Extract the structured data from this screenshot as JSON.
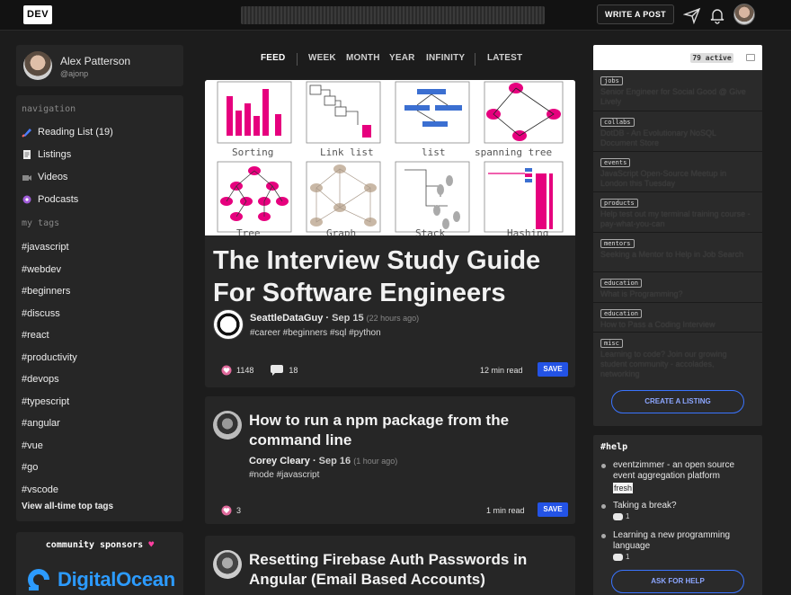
{
  "topnav": {
    "logo": "DEV",
    "write_post": "WRITE A POST"
  },
  "profile": {
    "name": "Alex Patterson",
    "handle": "@ajonp"
  },
  "sidebar": {
    "nav_title": "navigation",
    "nav_items": [
      {
        "label": "Reading List (19)",
        "icon": "bookmark-icon"
      },
      {
        "label": "Listings",
        "icon": "listings-icon"
      },
      {
        "label": "Videos",
        "icon": "camera-icon"
      },
      {
        "label": "Podcasts",
        "icon": "podcast-icon"
      }
    ],
    "tags_title": "my tags",
    "tags": [
      "#javascript",
      "#webdev",
      "#beginners",
      "#discuss",
      "#react",
      "#productivity",
      "#devops",
      "#typescript",
      "#angular",
      "#vue",
      "#go",
      "#vscode"
    ],
    "view_all": "View all-time top tags"
  },
  "sponsors": {
    "title": "community sponsors",
    "sponsor_name": "DigitalOcean"
  },
  "feed_tabs": [
    "FEED",
    "WEEK",
    "MONTH",
    "YEAR",
    "INFINITY",
    "LATEST"
  ],
  "featured": {
    "cover_labels": [
      "Sorting",
      "Link list",
      "list",
      "spanning tree",
      "Tree",
      "Graph",
      "Stack",
      "Hashing"
    ],
    "title": "The Interview Study Guide For Software Engineers",
    "author": "SeattleDataGuy",
    "date": "Sep 15",
    "ago": "(22 hours ago)",
    "tags": "#career #beginners #sql #python",
    "reactions": "1148",
    "comments": "18",
    "read_time": "12 min read",
    "save": "SAVE"
  },
  "posts": [
    {
      "title": "How to run a npm package from the command line",
      "author": "Corey Cleary",
      "date": "Sep 16",
      "ago": "(1 hour ago)",
      "tags": "#node #javascript",
      "reactions": "3",
      "read_time": "1 min read",
      "save": "SAVE"
    },
    {
      "title": "Resetting Firebase Auth Passwords in Angular (Email Based Accounts)"
    }
  ],
  "listings": {
    "active": "79 active",
    "rows": [
      {
        "badge": "jobs",
        "text": "Senior Engineer for Social Good @ Give Lively"
      },
      {
        "badge": "collabs",
        "text": "DotDB - An Evolutionary NoSQL Document Store"
      },
      {
        "badge": "events",
        "text": "JavaScript Open-Source Meetup in London this Tuesday"
      },
      {
        "badge": "products",
        "text": "Help test out my terminal training course - pay-what-you-can"
      },
      {
        "badge": "mentors",
        "text": "Seeking a Mentor to Help in Job Search"
      },
      {
        "badge": "education",
        "text": "What is Programming?"
      },
      {
        "badge": "education",
        "text": "How to Pass a Coding Interview"
      },
      {
        "badge": "misc",
        "text": "Learning to code? Join our growing student community - accolades, networking"
      }
    ],
    "create": "CREATE A LISTING"
  },
  "help": {
    "title": "#help",
    "items": [
      {
        "text": "eventzimmer - an open source event aggregation platform",
        "badge": "fresh",
        "count": ""
      },
      {
        "text": "Taking a break?",
        "count": "1"
      },
      {
        "text": "Learning a new programming language",
        "count": "1"
      }
    ],
    "ask": "ASK FOR HELP"
  },
  "colors": {
    "accent": "#2353e6",
    "pink": "#e6007e",
    "background": "#1c1c1c"
  }
}
